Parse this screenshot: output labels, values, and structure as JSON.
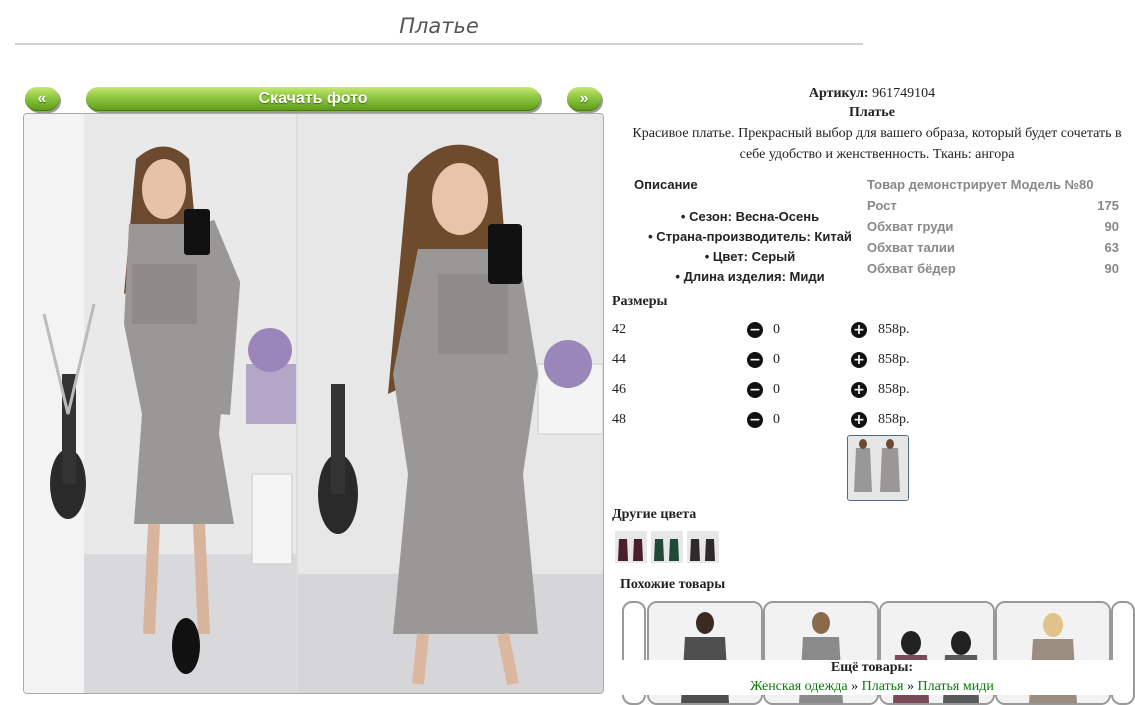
{
  "page": {
    "title": "Платье"
  },
  "nav": {
    "prev": "«",
    "download": "Скачать фото",
    "next": "»"
  },
  "product": {
    "article_label": "Артикул:",
    "article": "961749104",
    "name": "Платье",
    "description": "Красивое платье. Прекрасный выбор для вашего образа, который будет сочетать в себе удобство и женственность. Ткань: ангора"
  },
  "description_block": {
    "heading": "Описание",
    "items": [
      "Сезон: Весна-Осень",
      "Страна-производитель: Китай",
      "Цвет: Серый",
      "Длина изделия: Миди"
    ]
  },
  "model": {
    "heading": "Товар демонстрирует Модель №80",
    "rows": [
      {
        "label": "Рост",
        "value": "175"
      },
      {
        "label": "Обхват груди",
        "value": "90"
      },
      {
        "label": "Обхват талии",
        "value": "63"
      },
      {
        "label": "Обхват бёдер",
        "value": "90"
      }
    ]
  },
  "sizes": {
    "heading": "Размеры",
    "minus_icon": "−",
    "plus_icon": "+",
    "rows": [
      {
        "size": "42",
        "qty": "0",
        "price": "858р."
      },
      {
        "size": "44",
        "qty": "0",
        "price": "858р."
      },
      {
        "size": "46",
        "qty": "0",
        "price": "858р."
      },
      {
        "size": "48",
        "qty": "0",
        "price": "858р."
      }
    ]
  },
  "other_colors": {
    "heading": "Другие цвета",
    "swatches": [
      "#4a1f2a",
      "#1f4a35",
      "#2e2a2a"
    ]
  },
  "similar": {
    "heading": "Похожие товары"
  },
  "more": {
    "heading": "Ещё товары:",
    "crumbs": [
      "Женская одежда",
      "Платья",
      "Платья миди"
    ],
    "separator": "»"
  },
  "colors": {
    "accent_green": "#8cc63f",
    "link_green": "#0a7a0a",
    "dress_gray": "#9a9897"
  }
}
